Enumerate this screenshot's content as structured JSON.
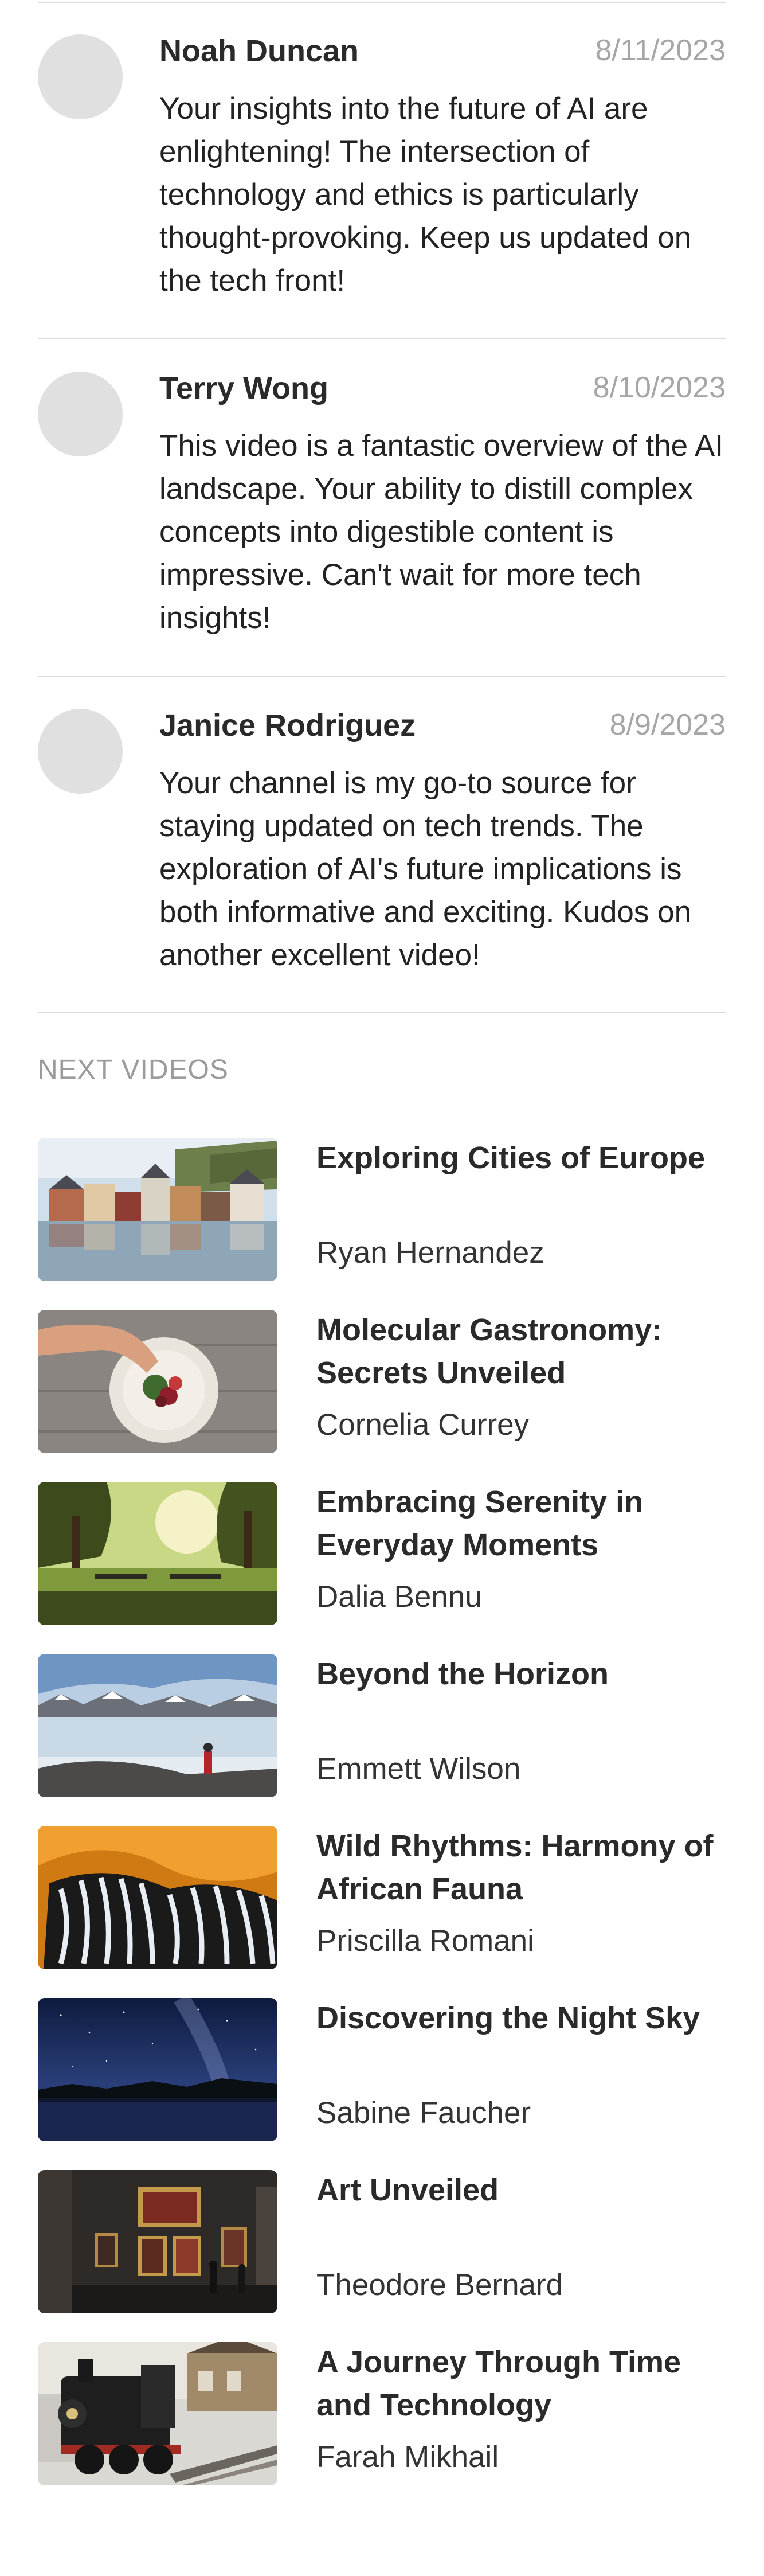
{
  "comments": [
    {
      "author": "Noah Duncan",
      "date": "8/11/2023",
      "text": "Your insights into the future of AI are enlightening! The intersection of technology and ethics is particularly thought-provoking. Keep us updated on the tech front!"
    },
    {
      "author": "Terry Wong",
      "date": "8/10/2023",
      "text": "This video is a fantastic overview of the AI landscape. Your ability to distill complex concepts into digestible content is impressive. Can't wait for more tech insights!"
    },
    {
      "author": "Janice Rodriguez",
      "date": "8/9/2023",
      "text": "Your channel is my go-to source for staying updated on tech trends. The exploration of AI's future implications is both informative and exciting. Kudos on another excellent video!"
    }
  ],
  "next_videos": {
    "heading": "NEXT VIDEOS",
    "items": [
      {
        "title": "Exploring Cities of Europe",
        "author": "Ryan Hernandez",
        "thumbnail_icon": "european-river-town-thumbnail"
      },
      {
        "title": "Molecular Gastronomy: Secrets Unveiled",
        "author": "Cornelia Currey",
        "thumbnail_icon": "plated-dish-thumbnail"
      },
      {
        "title": "Embracing Serenity in Everyday Moments",
        "author": "Dalia Bennu",
        "thumbnail_icon": "park-trees-thumbnail"
      },
      {
        "title": "Beyond the Horizon",
        "author": "Emmett Wilson",
        "thumbnail_icon": "arctic-landscape-thumbnail"
      },
      {
        "title": "Wild Rhythms: Harmony of African Fauna",
        "author": "Priscilla Romani",
        "thumbnail_icon": "zebras-thumbnail"
      },
      {
        "title": "Discovering the Night Sky",
        "author": "Sabine Faucher",
        "thumbnail_icon": "night-sky-lake-thumbnail"
      },
      {
        "title": "Art Unveiled",
        "author": "Theodore Bernard",
        "thumbnail_icon": "art-gallery-thumbnail"
      },
      {
        "title": "A Journey Through Time and Technology",
        "author": "Farah Mikhail",
        "thumbnail_icon": "steam-locomotive-thumbnail"
      }
    ]
  }
}
